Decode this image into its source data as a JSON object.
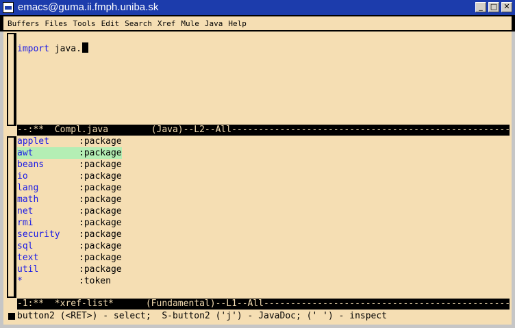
{
  "window": {
    "title": "emacs@guma.ii.fmph.uniba.sk",
    "min": "_",
    "max": "□",
    "close": "✕"
  },
  "menubar": [
    "Buffers",
    "Files",
    "Tools",
    "Edit",
    "Search",
    "Xref",
    "Mule",
    "Java",
    "Help"
  ],
  "editor": {
    "keyword": "import",
    "text": " java."
  },
  "modeline_top": "--:**  Compl.java        (Java)--L2--All------------------------------------------------------------",
  "xref_list": [
    {
      "name": "applet",
      "type": ":package",
      "selected": false
    },
    {
      "name": "awt",
      "type": ":package",
      "selected": true
    },
    {
      "name": "beans",
      "type": ":package",
      "selected": false
    },
    {
      "name": "io",
      "type": ":package",
      "selected": false
    },
    {
      "name": "lang",
      "type": ":package",
      "selected": false
    },
    {
      "name": "math",
      "type": ":package",
      "selected": false
    },
    {
      "name": "net",
      "type": ":package",
      "selected": false
    },
    {
      "name": "rmi",
      "type": ":package",
      "selected": false
    },
    {
      "name": "security",
      "type": ":package",
      "selected": false
    },
    {
      "name": "sql",
      "type": ":package",
      "selected": false
    },
    {
      "name": "text",
      "type": ":package",
      "selected": false
    },
    {
      "name": "util",
      "type": ":package",
      "selected": false
    },
    {
      "name": "*",
      "type": ":token",
      "selected": false
    }
  ],
  "modeline_bottom": "-1:**  *xref-list*      (Fundamental)--L1--All------------------------------------------------------",
  "echo": "button2 (<RET>) - select;  S-button2 ('j') - JavaDoc; (' ') - inspect",
  "colors": {
    "background": "#f5deb3",
    "titlebar": "#1c3cac",
    "selection": "#b4eeb4",
    "keyword": "#1a1ae6"
  }
}
